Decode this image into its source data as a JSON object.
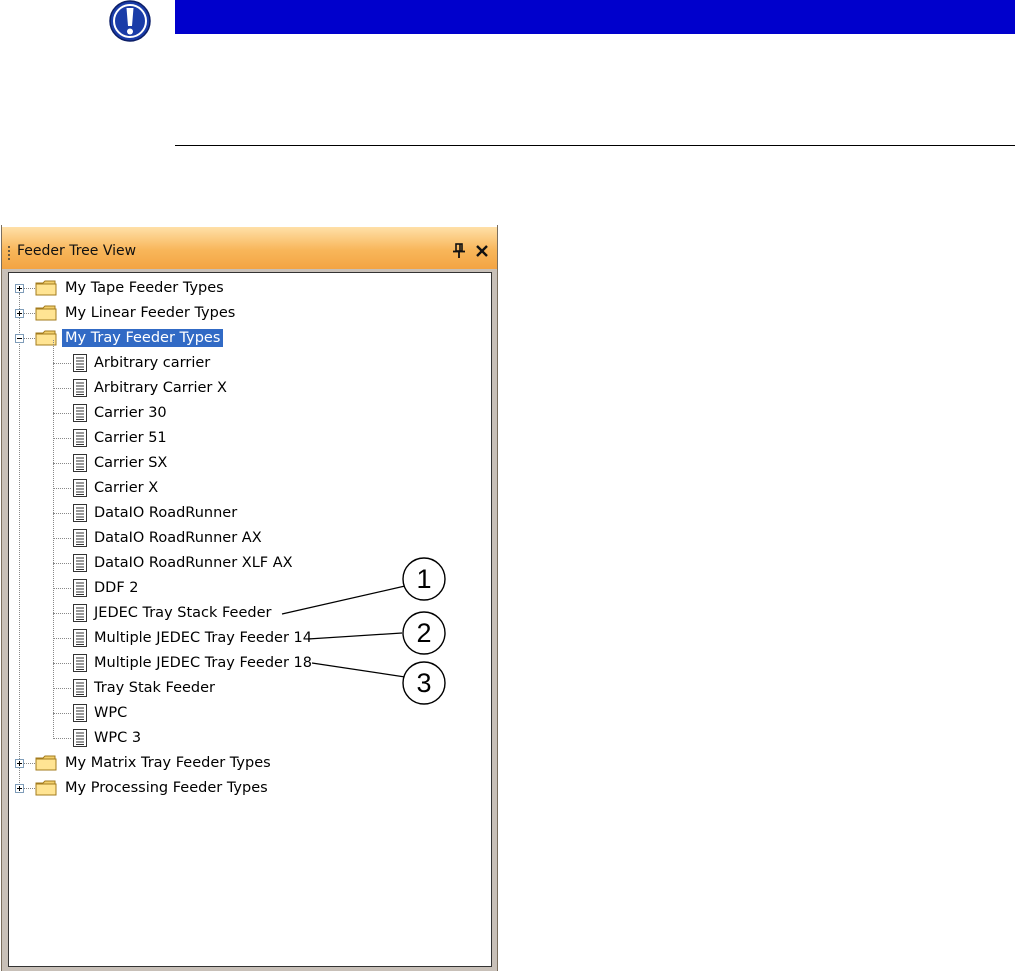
{
  "note": {
    "icon": "exclamation-icon",
    "bar_color": "#0000cc",
    "icon_color": "#1a3ca8"
  },
  "panel": {
    "title": "Feeder Tree View",
    "pin_icon": "pin-icon",
    "close_icon": "close-icon"
  },
  "tree": {
    "selected_color": "#316ac5",
    "folders": [
      {
        "label": "My Tape Feeder Types",
        "expanded": false
      },
      {
        "label": "My Linear Feeder Types",
        "expanded": false
      },
      {
        "label": "My Tray Feeder Types",
        "expanded": true,
        "selected": true,
        "children": [
          "Arbitrary carrier",
          "Arbitrary Carrier X",
          "Carrier 30",
          "Carrier 51",
          "Carrier SX",
          "Carrier X",
          "DataIO RoadRunner",
          "DataIO RoadRunner AX",
          "DataIO RoadRunner XLF AX",
          "DDF 2",
          "JEDEC Tray Stack Feeder",
          "Multiple JEDEC Tray Feeder 14",
          "Multiple JEDEC Tray Feeder 18",
          "Tray Stak Feeder",
          "WPC",
          "WPC 3"
        ]
      },
      {
        "label": "My Matrix Tray Feeder Types",
        "expanded": false
      },
      {
        "label": "My Processing Feeder Types",
        "expanded": false
      }
    ]
  },
  "callouts": [
    {
      "number": "1",
      "target": "JEDEC Tray Stack Feeder"
    },
    {
      "number": "2",
      "target": "Multiple JEDEC Tray Feeder 14"
    },
    {
      "number": "3",
      "target": "Multiple JEDEC Tray Feeder 18"
    }
  ]
}
